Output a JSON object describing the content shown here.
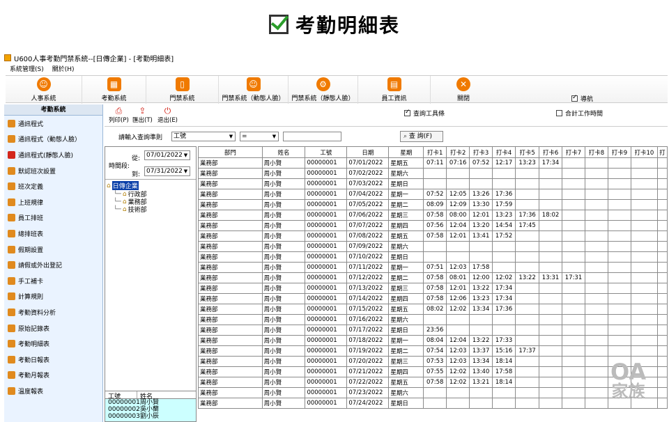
{
  "banner_title": "考勤明細表",
  "window_title": "U600人事考勤門禁系統--[日傳企業] - [考勤明細表]",
  "menu": [
    "系統管理(S)",
    "關於(H)"
  ],
  "toolbar": [
    {
      "label": "人事系統",
      "icon": "person-icon",
      "color": "#f07a00"
    },
    {
      "label": "考勤系統",
      "icon": "calendar-icon",
      "color": "#f07a00"
    },
    {
      "label": "門禁系統",
      "icon": "door-icon",
      "color": "#f07a00"
    },
    {
      "label": "門禁系統（動態人臉）",
      "icon": "face-icon",
      "color": "#f07a00"
    },
    {
      "label": "門禁系統（靜態人臉）",
      "icon": "gear-face-icon",
      "color": "#f07a00"
    },
    {
      "label": "員工資訊",
      "icon": "id-card-icon",
      "color": "#f07a00"
    },
    {
      "label": "關閉",
      "icon": "close-icon",
      "color": "#f07a00"
    }
  ],
  "nav_label": "導航",
  "sidebar": {
    "title": "考勤系統",
    "items": [
      {
        "label": "通訊程式",
        "color": "#e08a1e"
      },
      {
        "label": "通訊程式（動態人臉）",
        "color": "#e08a1e"
      },
      {
        "label": "通訊程式(靜態人臉)",
        "color": "#d3271c"
      },
      {
        "label": "默認班次設置",
        "color": "#e08a1e"
      },
      {
        "label": "班次定義",
        "color": "#e08a1e"
      },
      {
        "label": "上班規律",
        "color": "#e08a1e"
      },
      {
        "label": "員工排班",
        "color": "#e08a1e"
      },
      {
        "label": "總排班表",
        "color": "#e08a1e"
      },
      {
        "label": "假期設置",
        "color": "#e08a1e"
      },
      {
        "label": "請假或外出登記",
        "color": "#e08a1e"
      },
      {
        "label": "手工補卡",
        "color": "#e08a1e"
      },
      {
        "label": "計算規則",
        "color": "#e08a1e"
      },
      {
        "label": "考勤資料分析",
        "color": "#e08a1e"
      },
      {
        "label": "原始記錄表",
        "color": "#e08a1e"
      },
      {
        "label": "考勤明細表",
        "color": "#e08a1e"
      },
      {
        "label": "考勤日報表",
        "color": "#e08a1e"
      },
      {
        "label": "考勤月報表",
        "color": "#e08a1e"
      },
      {
        "label": "溫度報表",
        "color": "#e08a1e"
      }
    ]
  },
  "subtool": {
    "print": "列印(P)",
    "export": "匯出(T)",
    "exit": "退出(E)",
    "query_toolbar": "查詢工具條",
    "sum_hours": "合計工作時間"
  },
  "query": {
    "prompt": "請輸入查詢準則",
    "field": "工號",
    "op": "=",
    "value": "",
    "button": "查 詢(F)"
  },
  "period": {
    "label": "時間段:",
    "from_label": "從:",
    "from": "07/01/2022",
    "to_label": "到:",
    "to": "07/31/2022"
  },
  "tree": {
    "root": "日傳企業",
    "children": [
      "行政部",
      "業務部",
      "技術部"
    ]
  },
  "employees": {
    "headers": [
      "工號",
      "姓名"
    ],
    "rows": [
      [
        "00000001",
        "周小賢"
      ],
      [
        "00000002",
        "吳小蘭"
      ],
      [
        "00000003",
        "劉小辰"
      ]
    ]
  },
  "table": {
    "headers": [
      "部門",
      "姓名",
      "工號",
      "日期",
      "星期",
      "打卡1",
      "打卡2",
      "打卡3",
      "打卡4",
      "打卡5",
      "打卡6",
      "打卡7",
      "打卡8",
      "打卡9",
      "打卡10",
      "打"
    ],
    "rows": [
      [
        "業務部",
        "周小賢",
        "00000001",
        "07/01/2022",
        "星期五",
        "07:11",
        "07:16",
        "07:52",
        "12:17",
        "13:23",
        "17:34",
        "",
        "",
        "",
        "",
        ""
      ],
      [
        "業務部",
        "周小賢",
        "00000001",
        "07/02/2022",
        "星期六",
        "",
        "",
        "",
        "",
        "",
        "",
        "",
        "",
        "",
        "",
        ""
      ],
      [
        "業務部",
        "周小賢",
        "00000001",
        "07/03/2022",
        "星期日",
        "",
        "",
        "",
        "",
        "",
        "",
        "",
        "",
        "",
        "",
        ""
      ],
      [
        "業務部",
        "周小賢",
        "00000001",
        "07/04/2022",
        "星期一",
        "07:52",
        "12:05",
        "13:26",
        "17:36",
        "",
        "",
        "",
        "",
        "",
        "",
        ""
      ],
      [
        "業務部",
        "周小賢",
        "00000001",
        "07/05/2022",
        "星期二",
        "08:09",
        "12:09",
        "13:30",
        "17:59",
        "",
        "",
        "",
        "",
        "",
        "",
        ""
      ],
      [
        "業務部",
        "周小賢",
        "00000001",
        "07/06/2022",
        "星期三",
        "07:58",
        "08:00",
        "12:01",
        "13:23",
        "17:36",
        "18:02",
        "",
        "",
        "",
        "",
        ""
      ],
      [
        "業務部",
        "周小賢",
        "00000001",
        "07/07/2022",
        "星期四",
        "07:56",
        "12:04",
        "13:20",
        "14:54",
        "17:45",
        "",
        "",
        "",
        "",
        "",
        ""
      ],
      [
        "業務部",
        "周小賢",
        "00000001",
        "07/08/2022",
        "星期五",
        "07:58",
        "12:01",
        "13:41",
        "17:52",
        "",
        "",
        "",
        "",
        "",
        "",
        ""
      ],
      [
        "業務部",
        "周小賢",
        "00000001",
        "07/09/2022",
        "星期六",
        "",
        "",
        "",
        "",
        "",
        "",
        "",
        "",
        "",
        "",
        ""
      ],
      [
        "業務部",
        "周小賢",
        "00000001",
        "07/10/2022",
        "星期日",
        "",
        "",
        "",
        "",
        "",
        "",
        "",
        "",
        "",
        "",
        ""
      ],
      [
        "業務部",
        "周小賢",
        "00000001",
        "07/11/2022",
        "星期一",
        "07:51",
        "12:03",
        "17:58",
        "",
        "",
        "",
        "",
        "",
        "",
        "",
        ""
      ],
      [
        "業務部",
        "周小賢",
        "00000001",
        "07/12/2022",
        "星期二",
        "07:58",
        "08:01",
        "12:00",
        "12:02",
        "13:22",
        "13:31",
        "17:31",
        "",
        "",
        "",
        ""
      ],
      [
        "業務部",
        "周小賢",
        "00000001",
        "07/13/2022",
        "星期三",
        "07:58",
        "12:01",
        "13:22",
        "17:34",
        "",
        "",
        "",
        "",
        "",
        "",
        ""
      ],
      [
        "業務部",
        "周小賢",
        "00000001",
        "07/14/2022",
        "星期四",
        "07:58",
        "12:06",
        "13:23",
        "17:34",
        "",
        "",
        "",
        "",
        "",
        "",
        ""
      ],
      [
        "業務部",
        "周小賢",
        "00000001",
        "07/15/2022",
        "星期五",
        "08:02",
        "12:02",
        "13:34",
        "17:36",
        "",
        "",
        "",
        "",
        "",
        "",
        ""
      ],
      [
        "業務部",
        "周小賢",
        "00000001",
        "07/16/2022",
        "星期六",
        "",
        "",
        "",
        "",
        "",
        "",
        "",
        "",
        "",
        "",
        ""
      ],
      [
        "業務部",
        "周小賢",
        "00000001",
        "07/17/2022",
        "星期日",
        "23:56",
        "",
        "",
        "",
        "",
        "",
        "",
        "",
        "",
        "",
        ""
      ],
      [
        "業務部",
        "周小賢",
        "00000001",
        "07/18/2022",
        "星期一",
        "08:04",
        "12:04",
        "13:22",
        "17:33",
        "",
        "",
        "",
        "",
        "",
        "",
        ""
      ],
      [
        "業務部",
        "周小賢",
        "00000001",
        "07/19/2022",
        "星期二",
        "07:54",
        "12:03",
        "13:37",
        "15:16",
        "17:37",
        "",
        "",
        "",
        "",
        "",
        ""
      ],
      [
        "業務部",
        "周小賢",
        "00000001",
        "07/20/2022",
        "星期三",
        "07:53",
        "12:03",
        "13:34",
        "18:14",
        "",
        "",
        "",
        "",
        "",
        "",
        ""
      ],
      [
        "業務部",
        "周小賢",
        "00000001",
        "07/21/2022",
        "星期四",
        "07:55",
        "12:02",
        "13:40",
        "17:58",
        "",
        "",
        "",
        "",
        "",
        "",
        ""
      ],
      [
        "業務部",
        "周小賢",
        "00000001",
        "07/22/2022",
        "星期五",
        "07:58",
        "12:02",
        "13:21",
        "18:14",
        "",
        "",
        "",
        "",
        "",
        "",
        ""
      ],
      [
        "業務部",
        "周小賢",
        "00000001",
        "07/23/2022",
        "星期六",
        "",
        "",
        "",
        "",
        "",
        "",
        "",
        "",
        "",
        "",
        ""
      ],
      [
        "業務部",
        "周小賢",
        "00000001",
        "07/24/2022",
        "星期日",
        "",
        "",
        "",
        "",
        "",
        "",
        "",
        "",
        "",
        "",
        ""
      ]
    ]
  },
  "watermark": {
    "line1": "OA",
    "line2": "家族"
  }
}
